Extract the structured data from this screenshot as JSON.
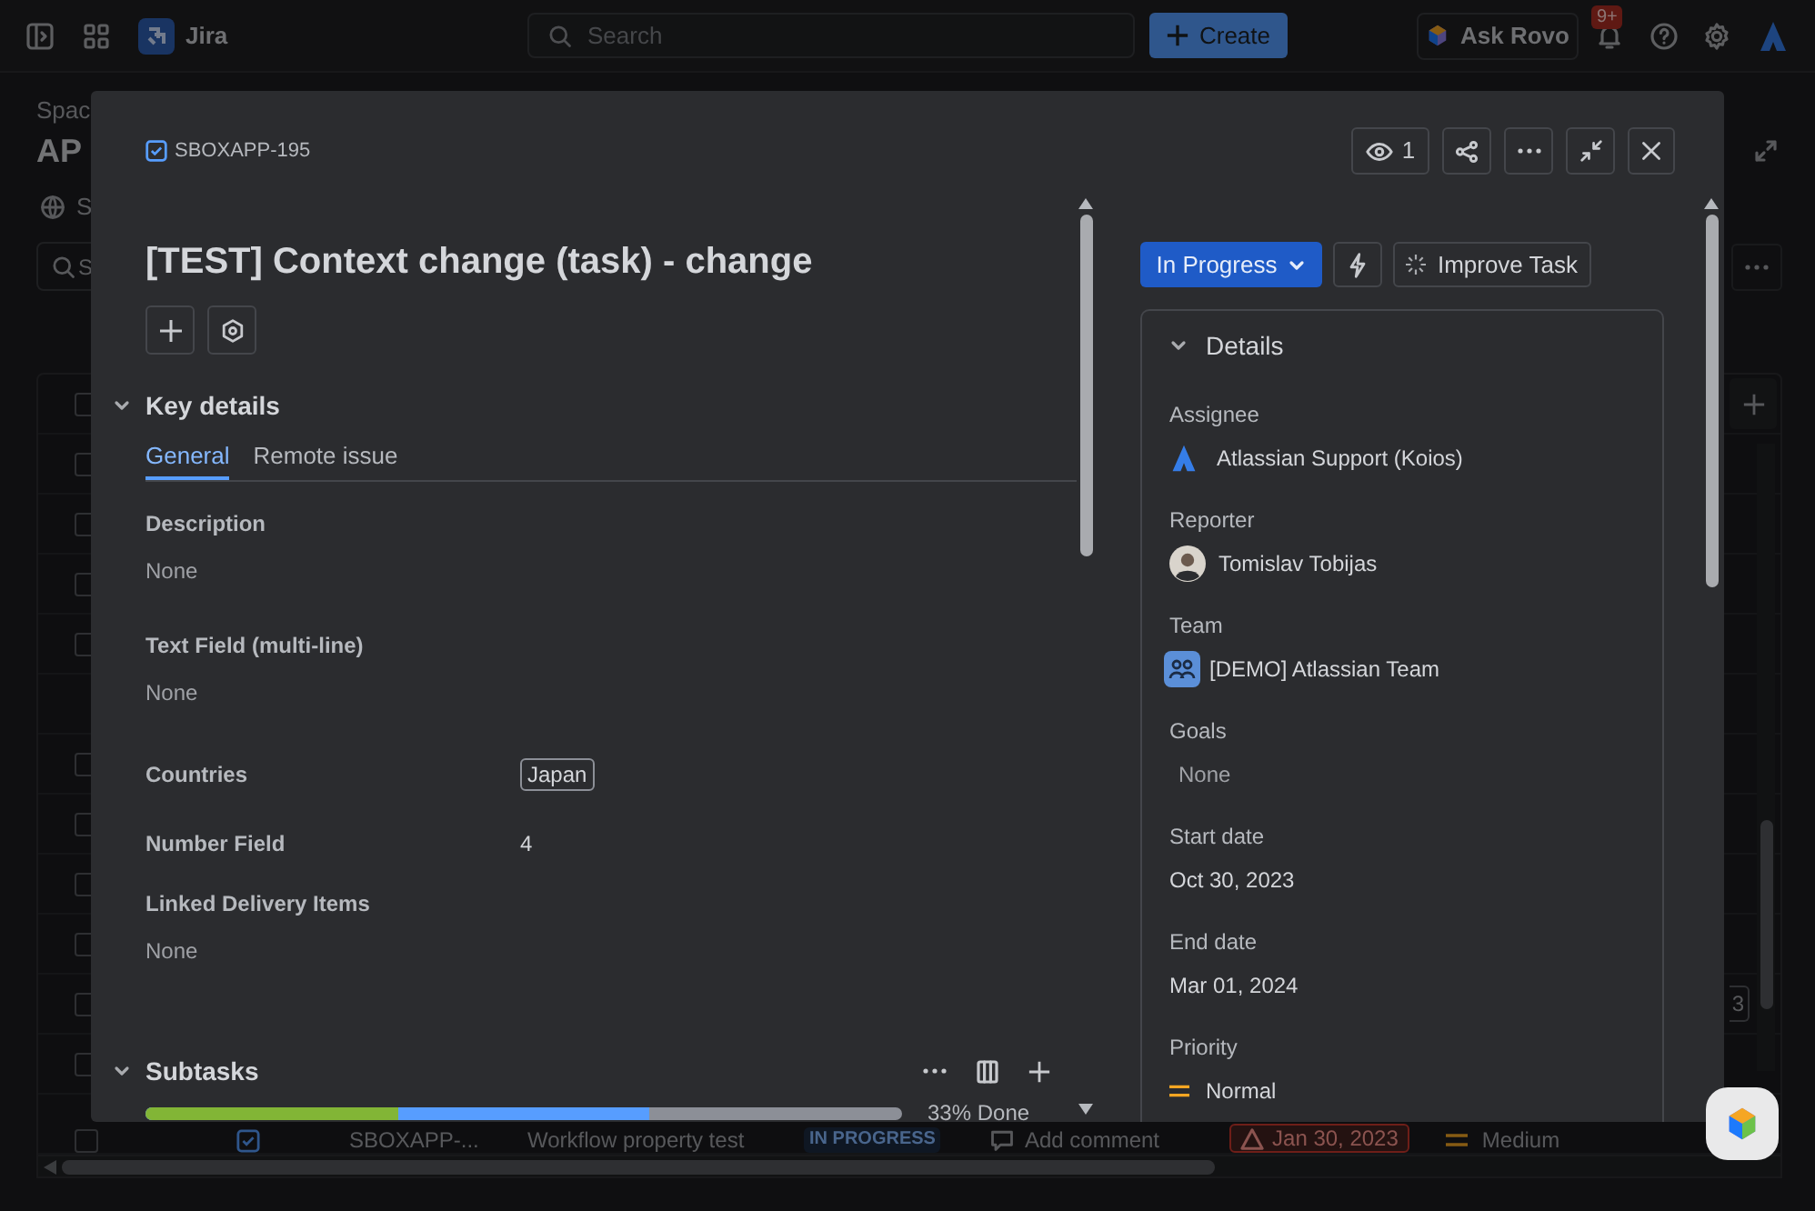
{
  "top_nav": {
    "app_name": "Jira",
    "search_placeholder": "Search",
    "create_label": "Create",
    "rovo_label": "Ask Rovo",
    "notification_count": "9+"
  },
  "background_page": {
    "breadcrumb": "Spac",
    "title": "AP",
    "tab_fragment": "S",
    "search_fragment": "S",
    "table_rows": [
      {
        "kind": "item",
        "checked": false
      },
      {
        "kind": "item",
        "checked": false
      },
      {
        "kind": "item",
        "checked": false
      },
      {
        "kind": "item",
        "checked": false
      },
      {
        "kind": "item",
        "checked": false
      },
      {
        "kind": "empty"
      },
      {
        "kind": "item",
        "checked": false
      },
      {
        "kind": "item",
        "checked": false
      },
      {
        "kind": "item",
        "checked": false
      },
      {
        "kind": "item",
        "checked": false
      },
      {
        "kind": "item",
        "checked": false,
        "cell_fragment": "3"
      },
      {
        "kind": "item",
        "checked": false
      }
    ],
    "visible_row": {
      "checked": false,
      "key": "SBOXAPP-...",
      "summary": "Workflow property test",
      "status": "IN PROGRESS",
      "comment_placeholder": "Add comment",
      "due_date": "Jan 30, 2023",
      "priority": "Medium"
    }
  },
  "issue_modal": {
    "issue_key": "SBOXAPP-195",
    "watchers": "1",
    "title": "[TEST] Context change (task) - change",
    "key_details": {
      "heading": "Key details",
      "expanded": true,
      "tabs": [
        {
          "label": "General",
          "selected": true
        },
        {
          "label": "Remote issue",
          "selected": false
        }
      ],
      "fields": [
        {
          "kind": "stacked",
          "label": "Description",
          "value": "None"
        },
        {
          "kind": "stacked",
          "label": "Text Field (multi-line)",
          "value": "None"
        },
        {
          "kind": "tag",
          "label": "Countries",
          "value": "Japan"
        },
        {
          "kind": "inline",
          "label": "Number Field",
          "value": "4"
        },
        {
          "kind": "stacked",
          "label": "Linked Delivery Items",
          "value": "None"
        }
      ]
    },
    "subtasks": {
      "heading": "Subtasks",
      "expanded": true,
      "progress_label": "33% Done",
      "segments": [
        {
          "kind": "done",
          "level": 0.333
        },
        {
          "kind": "in_progress",
          "level": 0.667
        }
      ]
    },
    "status": "In Progress",
    "improve_label": "Improve Task",
    "details": {
      "heading": "Details",
      "expanded": true,
      "fields": [
        {
          "kind": "atlassian",
          "label": "Assignee",
          "value": "Atlassian Support (Koios)"
        },
        {
          "kind": "person",
          "label": "Reporter",
          "value": "Tomislav Tobijas"
        },
        {
          "kind": "team",
          "label": "Team",
          "value": "[DEMO] Atlassian Team"
        },
        {
          "kind": "muted",
          "label": "Goals",
          "value": "None"
        },
        {
          "kind": "plain",
          "label": "Start date",
          "value": "Oct 30, 2023"
        },
        {
          "kind": "plain",
          "label": "End date",
          "value": "Mar 01, 2024"
        },
        {
          "kind": "priority",
          "label": "Priority",
          "value": "Normal"
        }
      ]
    }
  }
}
